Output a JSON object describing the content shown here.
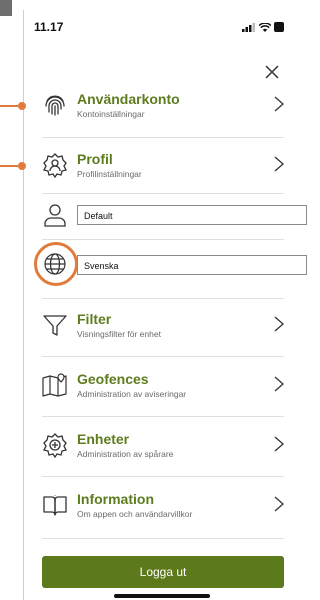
{
  "status_bar": {
    "time": "11.17"
  },
  "menu": [
    {
      "key": "account",
      "title": "Användarkonto",
      "subtitle": "Kontoinställningar",
      "icon": "fingerprint-icon"
    },
    {
      "key": "profile",
      "title": "Profil",
      "subtitle": "Profilinställningar",
      "icon": "gear-badge-icon"
    },
    {
      "key": "filter",
      "title": "Filter",
      "subtitle": "Visningsfilter för enhet",
      "icon": "funnel-icon"
    },
    {
      "key": "geofences",
      "title": "Geofences",
      "subtitle": "Administration av aviseringar",
      "icon": "map-pin-icon"
    },
    {
      "key": "units",
      "title": "Enheter",
      "subtitle": "Administration av spårare",
      "icon": "tracker-icon"
    },
    {
      "key": "info",
      "title": "Information",
      "subtitle": "Om appen och användarvillkor",
      "icon": "book-info-icon"
    }
  ],
  "user_field": {
    "value": "Default"
  },
  "language_field": {
    "value": "Svenska"
  },
  "logout_label": "Logga ut",
  "colors": {
    "accent": "#5d7c1e",
    "button": "#5c7a1b",
    "callout": "#e07b3c"
  }
}
